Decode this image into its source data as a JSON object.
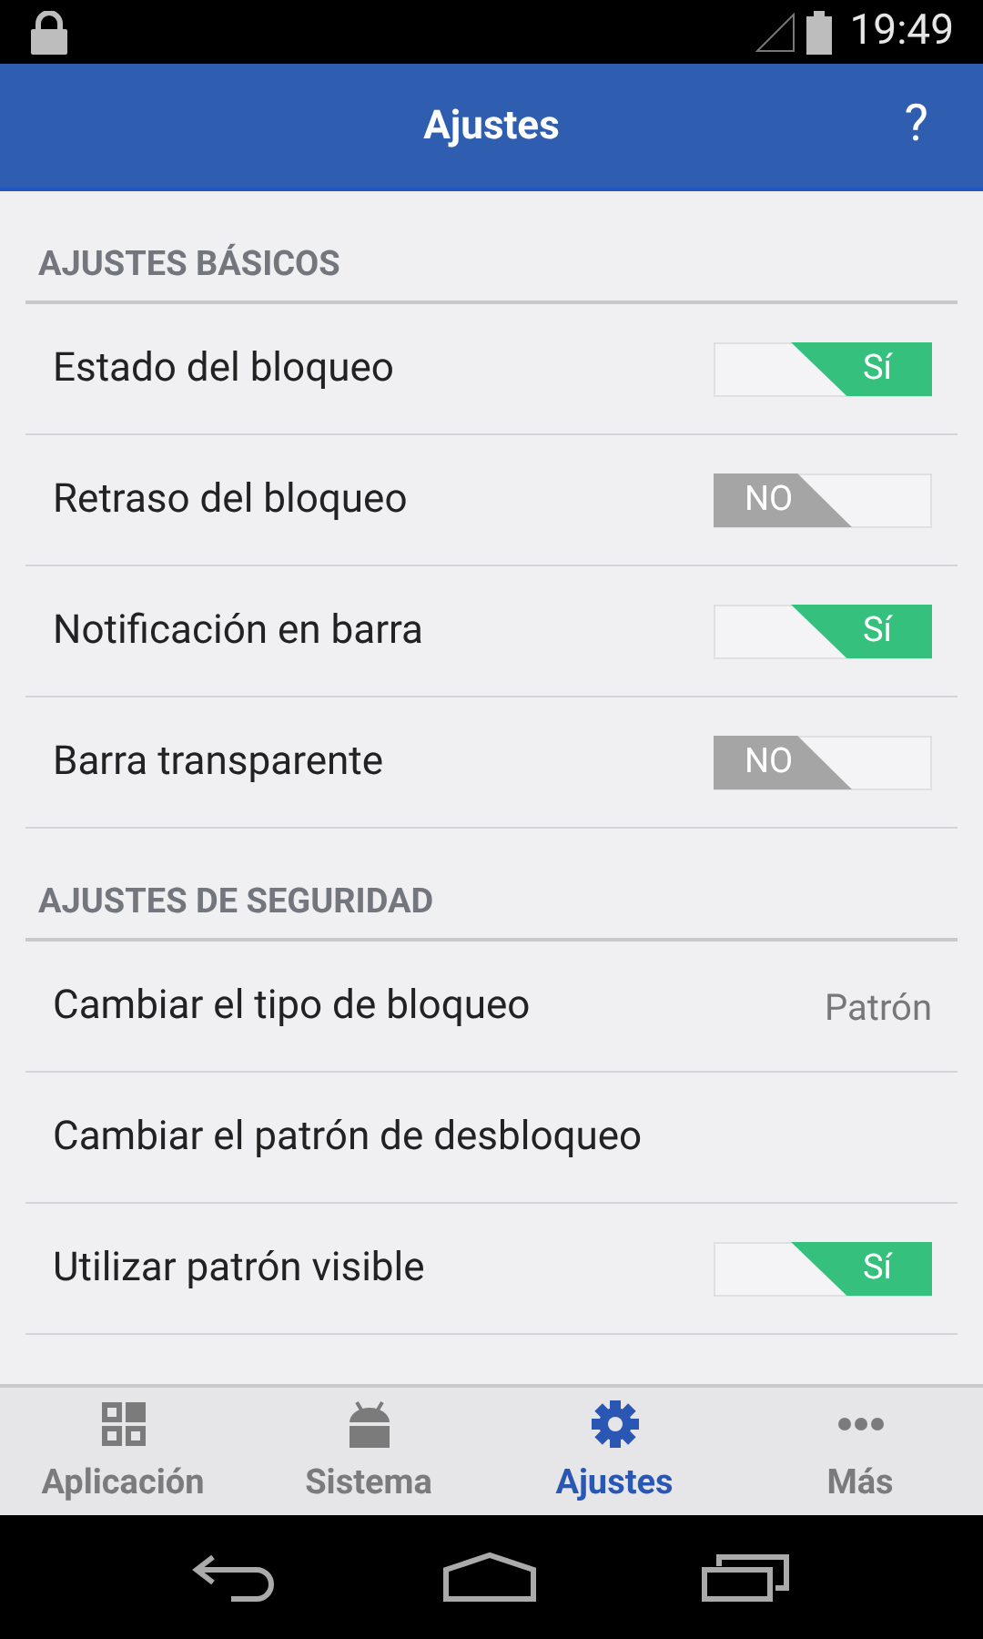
{
  "status_bar": {
    "time": "19:49"
  },
  "app_bar": {
    "title": "Ajustes",
    "help": "?"
  },
  "sections": [
    {
      "title": "AJUSTES BÁSICOS",
      "items": [
        {
          "kind": "toggle",
          "label": "Estado del bloqueo",
          "on": true,
          "state_text": "Sí"
        },
        {
          "kind": "toggle",
          "label": "Retraso del bloqueo",
          "on": false,
          "state_text": "NO"
        },
        {
          "kind": "toggle",
          "label": "Notificación en barra",
          "on": true,
          "state_text": "Sí"
        },
        {
          "kind": "toggle",
          "label": "Barra transparente",
          "on": false,
          "state_text": "NO"
        }
      ]
    },
    {
      "title": "AJUSTES DE SEGURIDAD",
      "items": [
        {
          "kind": "value",
          "label": "Cambiar el tipo de bloqueo",
          "value": "Patrón"
        },
        {
          "kind": "link",
          "label": "Cambiar el patrón de desbloqueo"
        },
        {
          "kind": "toggle",
          "label": "Utilizar patrón visible",
          "on": true,
          "state_text": "Sí"
        }
      ]
    }
  ],
  "bottom_nav": [
    {
      "label": "Aplicación",
      "selected": false
    },
    {
      "label": "Sistema",
      "selected": false
    },
    {
      "label": "Ajustes",
      "selected": true
    },
    {
      "label": "Más",
      "selected": false
    }
  ]
}
